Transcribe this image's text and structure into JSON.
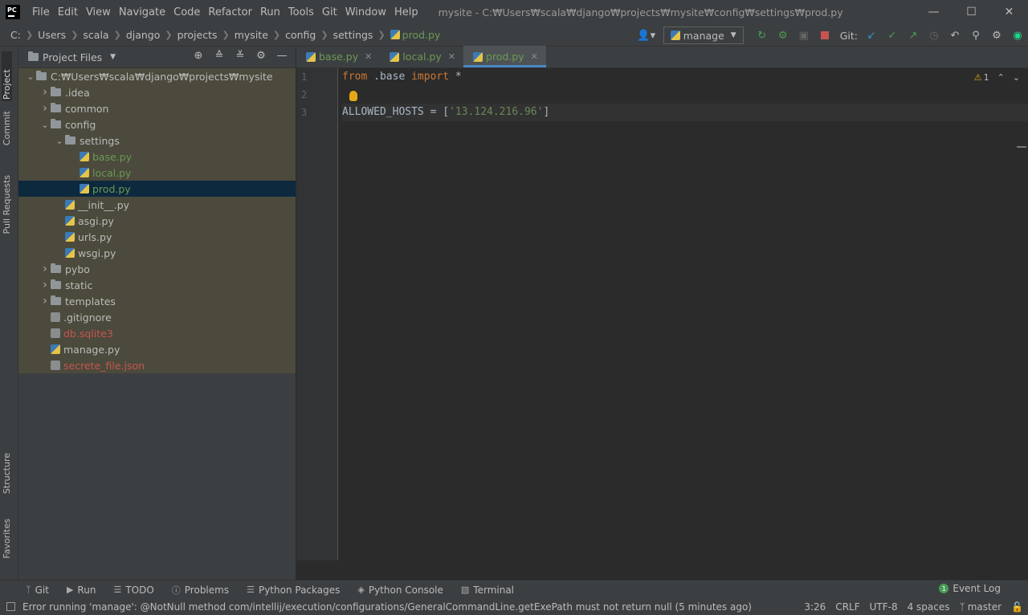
{
  "app": {
    "logo": "PC",
    "menu": [
      "File",
      "Edit",
      "View",
      "Navigate",
      "Code",
      "Refactor",
      "Run",
      "Tools",
      "Git",
      "Window",
      "Help"
    ],
    "window_title": "mysite - C:₩Users₩scala₩django₩projects₩mysite₩config₩settings₩prod.py"
  },
  "breadcrumbs": [
    "C:",
    "Users",
    "scala",
    "django",
    "projects",
    "mysite",
    "config",
    "settings",
    "prod.py"
  ],
  "toolbar": {
    "run_config": "manage",
    "git_label": "Git:"
  },
  "left_strip": {
    "project": "Project",
    "commit": "Commit",
    "pull_requests": "Pull Requests",
    "structure": "Structure",
    "favorites": "Favorites"
  },
  "project_panel": {
    "title": "Project Files",
    "tree": [
      {
        "label": "C:₩Users₩scala₩django₩projects₩mysite",
        "level": 0,
        "type": "folder",
        "expanded": true
      },
      {
        "label": ".idea",
        "level": 1,
        "type": "folder",
        "expanded": false
      },
      {
        "label": "common",
        "level": 1,
        "type": "folder",
        "expanded": false
      },
      {
        "label": "config",
        "level": 1,
        "type": "folder",
        "expanded": true
      },
      {
        "label": "settings",
        "level": 2,
        "type": "folder",
        "expanded": true
      },
      {
        "label": "base.py",
        "level": 3,
        "type": "py",
        "color": "green"
      },
      {
        "label": "local.py",
        "level": 3,
        "type": "py",
        "color": "green"
      },
      {
        "label": "prod.py",
        "level": 3,
        "type": "py",
        "color": "green",
        "selected": true
      },
      {
        "label": "__init__.py",
        "level": 2,
        "type": "py"
      },
      {
        "label": "asgi.py",
        "level": 2,
        "type": "py"
      },
      {
        "label": "urls.py",
        "level": 2,
        "type": "py"
      },
      {
        "label": "wsgi.py",
        "level": 2,
        "type": "py"
      },
      {
        "label": "pybo",
        "level": 1,
        "type": "folder",
        "expanded": false
      },
      {
        "label": "static",
        "level": 1,
        "type": "folder",
        "expanded": false
      },
      {
        "label": "templates",
        "level": 1,
        "type": "folder",
        "expanded": false
      },
      {
        "label": ".gitignore",
        "level": 1,
        "type": "gen"
      },
      {
        "label": "db.sqlite3",
        "level": 1,
        "type": "gen",
        "color": "red"
      },
      {
        "label": "manage.py",
        "level": 1,
        "type": "py"
      },
      {
        "label": "secrete_file.json",
        "level": 1,
        "type": "gen",
        "color": "red"
      }
    ]
  },
  "editor": {
    "tabs": [
      {
        "label": "base.py",
        "active": false
      },
      {
        "label": "local.py",
        "active": false
      },
      {
        "label": "prod.py",
        "active": true
      }
    ],
    "line_numbers": [
      "1",
      "2",
      "3"
    ],
    "line1": {
      "kw1": "from",
      "mid": " .base ",
      "kw2": "import",
      "rest": " *"
    },
    "line3": {
      "prefix": "ALLOWED_HOSTS = [",
      "str": "'13.124.216.96'",
      "suffix": "]"
    },
    "inspection": {
      "warnings": "1"
    }
  },
  "tool_windows": [
    "Git",
    "Run",
    "TODO",
    "Problems",
    "Python Packages",
    "Python Console",
    "Terminal"
  ],
  "event_log": {
    "count": "1",
    "label": "Event Log"
  },
  "status": {
    "message": "Error running 'manage': @NotNull method com/intellij/execution/configurations/GeneralCommandLine.getExePath must not return null (5 minutes ago)",
    "position": "3:26",
    "line_sep": "CRLF",
    "encoding": "UTF-8",
    "indent": "4 spaces",
    "branch": "master"
  }
}
